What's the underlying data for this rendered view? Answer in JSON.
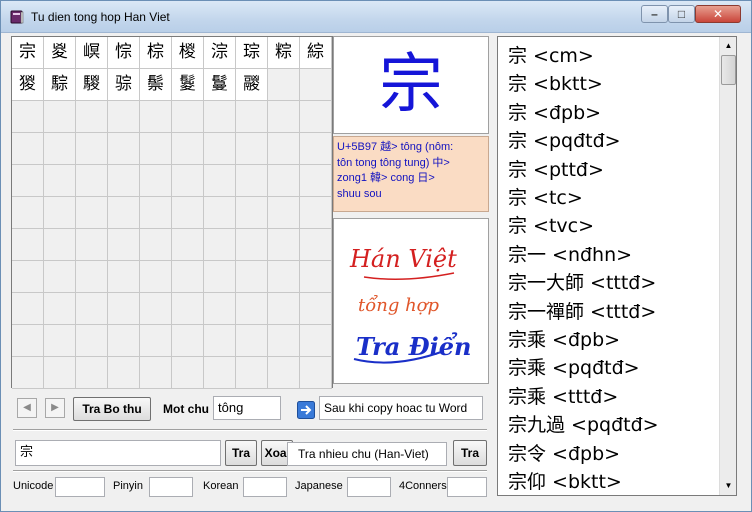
{
  "window": {
    "title": "Tu dien tong hop Han Viet"
  },
  "grid": {
    "rows": [
      [
        "宗",
        "㚇",
        "㟰",
        "悰",
        "棕",
        "椶",
        "淙",
        "琮",
        "粽",
        "綜"
      ],
      [
        "猣",
        "騌",
        "騣",
        "骔",
        "鬃",
        "鬉",
        "鬘",
        "鬷"
      ]
    ]
  },
  "detail": {
    "big_char": "宗",
    "info_lines": [
      "U+5B97  越> tông (nôm:",
      "tôn tong tông tung)  中>",
      "zong1  韓> cong  日>",
      "shuu sou"
    ],
    "logo": {
      "line1": "Hán Việt",
      "line2": "tổng hợp",
      "line3": "Tra Điển"
    }
  },
  "results": [
    "宗  <cm>",
    "宗 <bktt>",
    "宗 <đpb>",
    "宗 <pqđtđ>",
    "宗 <pttđ>",
    "宗 <tc>",
    "宗 <tvc>",
    "宗一 <nđhn>",
    "宗一大師 <tttđ>",
    "宗一禪師 <tttđ>",
    "宗乘 <đpb>",
    "宗乘 <pqđtđ>",
    "宗乘 <tttđ>",
    "宗九過 <pqđtđ>",
    "宗令 <đpb>",
    "宗仰 <bktt>"
  ],
  "controls": {
    "prev_glyph": "◀",
    "next_glyph": "▶",
    "tra_bo_thu_label": "Tra Bo thu",
    "mot_chu_label": "Mot chu",
    "mot_chu_value": "tông",
    "copy_note": "Sau khi copy hoac tu Word",
    "search_value": "宗",
    "tra_label": "Tra",
    "xoa_label": "Xoa'",
    "tra_nhieu_chu_label": "Tra nhieu chu (Han-Viet)",
    "tra2_label": "Tra"
  },
  "codes": {
    "unicode_label": "Unicode",
    "pinyin_label": "Pinyin",
    "korean_label": "Korean",
    "japanese_label": "Japanese",
    "fourcorners_label": "4Conners"
  },
  "colors": {
    "big_char": "#1515d8",
    "info_bg": "#fadcc4",
    "info_text": "#1212c0",
    "logo_red": "#d42020",
    "logo_blue": "#1a2fc8"
  }
}
